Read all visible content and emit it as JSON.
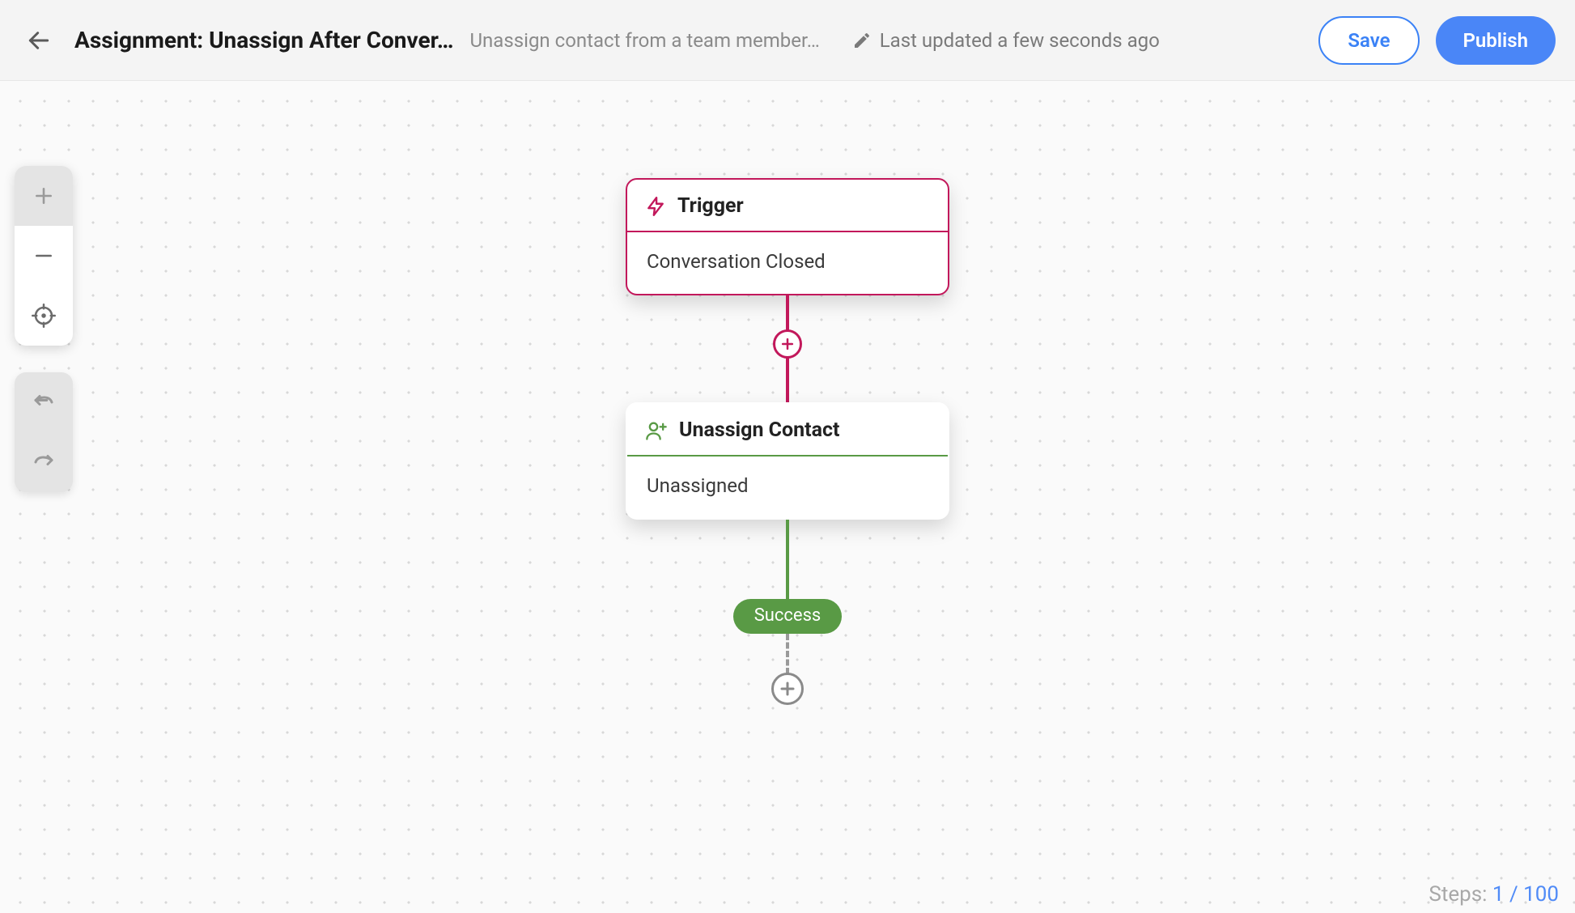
{
  "header": {
    "title": "Assignment: Unassign After Conver…",
    "subtitle": "Unassign contact from a team member…",
    "last_updated": "Last updated a few seconds ago",
    "save_label": "Save",
    "publish_label": "Publish"
  },
  "flow": {
    "trigger": {
      "title": "Trigger",
      "value": "Conversation Closed"
    },
    "action": {
      "title": "Unassign Contact",
      "value": "Unassigned"
    },
    "success_label": "Success"
  },
  "status": {
    "label": "Steps:",
    "current": "1",
    "separator": "/",
    "max": "100"
  },
  "colors": {
    "accent_pink": "#c2185b",
    "accent_green": "#599a45",
    "accent_blue": "#4a86f7"
  }
}
